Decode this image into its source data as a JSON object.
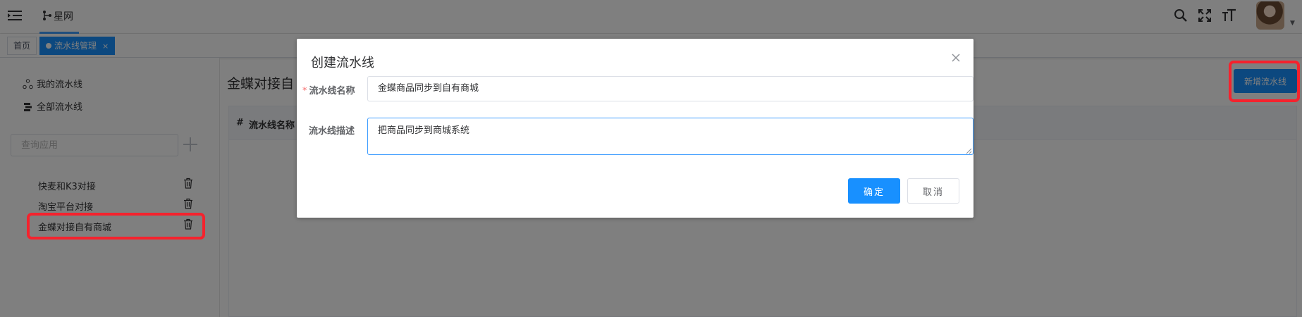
{
  "header": {
    "brand": "星网",
    "icons": [
      "menu-icon",
      "pipeline-icon",
      "search-icon",
      "fullscreen-icon",
      "font-size-icon",
      "avatar",
      "chevron-down-icon"
    ]
  },
  "tags": {
    "home": "首页",
    "active": "流水线管理",
    "close": "×"
  },
  "sidebar": {
    "my_pipelines": "我的流水线",
    "all_pipelines": "全部流水线",
    "search_placeholder": "查询应用",
    "apps": [
      {
        "label": "快麦和K3对接"
      },
      {
        "label": "淘宝平台对接"
      },
      {
        "label": "金蝶对接自有商城"
      }
    ]
  },
  "main": {
    "title": "金蝶对接自",
    "add_button": "新增流水线",
    "table": {
      "columns": [
        "#",
        "流水线名称"
      ]
    }
  },
  "dialog": {
    "title": "创建流水线",
    "name_label": "流水线名称",
    "name_required_mark": "*",
    "name_value": "金蝶商品同步到自有商城",
    "desc_label": "流水线描述",
    "desc_value": "把商品同步到商城系统",
    "ok": "确定",
    "cancel": "取消"
  },
  "colors": {
    "primary": "#1890ff",
    "highlight": "#f5222d",
    "mask": "rgba(0,0,0,0.5)"
  }
}
